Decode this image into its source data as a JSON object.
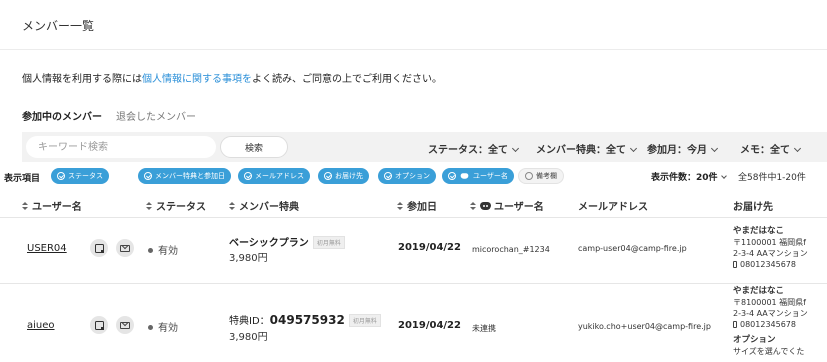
{
  "header": {
    "title": "メンバー一覧"
  },
  "notice": {
    "before": "個人情報を利用する際には",
    "link": "個人情報に関する事項を",
    "after": "よく読み、ご同意の上でご利用ください。"
  },
  "tabs": {
    "active": "参加中のメンバー",
    "inactive": "退会したメンバー"
  },
  "search": {
    "placeholder": "キーワード検索",
    "value": "",
    "button": "検索"
  },
  "filters": {
    "status": "ステータス：全て",
    "benefit": "メンバー特典：全て",
    "month": "参加月：今月",
    "memo": "メモ：全て"
  },
  "display": {
    "label": "表示項目",
    "chips": [
      {
        "label": "ステータス",
        "checked": true
      },
      {
        "label": "メンバー特典と参加日",
        "checked": true
      },
      {
        "label": "メールアドレス",
        "checked": true
      },
      {
        "label": "お届け先",
        "checked": true
      },
      {
        "label": "オプション",
        "checked": true
      },
      {
        "label": "ユーザー名",
        "checked": true
      },
      {
        "label": "備考欄",
        "checked": false
      }
    ],
    "count": "表示件数：20件",
    "range": "全58件中1-20件"
  },
  "columns": {
    "username": "ユーザー名",
    "status": "ステータス",
    "benefit": "メンバー特典",
    "joined": "参加日",
    "discord": "ユーザー名",
    "email": "メールアドレス",
    "delivery": "お届け先"
  },
  "rows": [
    {
      "username": "USER04",
      "status": "有効",
      "plan": "ベーシックプラン",
      "tag": "初月無料",
      "price": "3,980円",
      "joined": "2019/04/22",
      "discord": "micorochan_#1234",
      "email": "camp-user04@camp-fire.jp",
      "delivery": {
        "name": "やまだはなこ",
        "line1": "〒1100001 福岡県f",
        "line2": "2-3-4 AAマンション",
        "phone": "08012345678"
      }
    },
    {
      "username": "aiueo",
      "status": "有効",
      "plan_prefix": "特典ID：",
      "plan_id": "049575932",
      "tag": "初月無料",
      "price": "3,980円",
      "joined": "2019/04/22",
      "discord": "未連携",
      "email": "yukiko.cho+user04@camp-fire.jp",
      "delivery": {
        "name": "やまだはなこ",
        "line1": "〒8100001 福岡県f",
        "line2": "2-3-4 AAマンション",
        "phone": "08012345678",
        "option_label": "オプション",
        "option_text": "サイズを選んでくた"
      }
    }
  ]
}
